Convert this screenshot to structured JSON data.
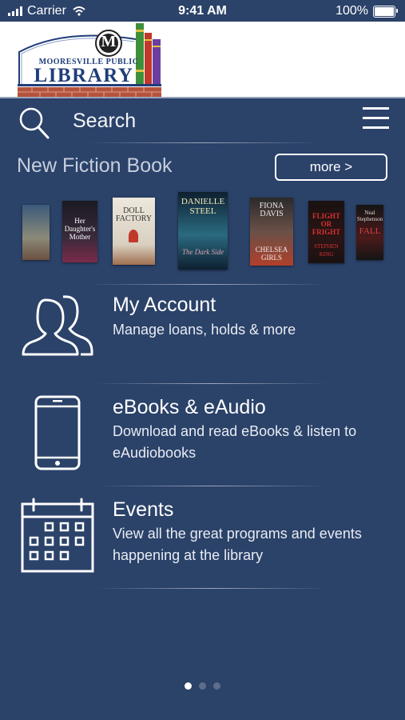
{
  "status_bar": {
    "carrier": "Carrier",
    "time": "9:41 AM",
    "battery": "100%"
  },
  "header": {
    "logo_line1": "MOORESVILLE PUBLIC",
    "logo_line2": "LIBRARY",
    "logo_monogram": "M"
  },
  "search": {
    "label": "Search"
  },
  "new_fiction": {
    "title": "New Fiction Book",
    "more_label": "more >",
    "books": [
      {
        "title": "",
        "author": ""
      },
      {
        "title": "Her Daughter's Mother",
        "author": ""
      },
      {
        "title": "DOLL FACTORY",
        "author": ""
      },
      {
        "title": "The Dark Side",
        "author": "DANIELLE STEEL"
      },
      {
        "title": "CHELSEA GIRLS",
        "author": "FIONA DAVIS"
      },
      {
        "title": "FLIGHT OR FRIGHT",
        "author": "STEPHEN KING"
      },
      {
        "title": "FALL",
        "author": "Neal Stephenson"
      }
    ]
  },
  "menu": [
    {
      "title": "My Account",
      "desc": "Manage loans, holds & more",
      "icon": "users-icon"
    },
    {
      "title": "eBooks & eAudio",
      "desc": "Download and read eBooks & listen to eAudiobooks",
      "icon": "phone-icon"
    },
    {
      "title": "Events",
      "desc": "View all the great programs and events happening at the library",
      "icon": "calendar-icon"
    }
  ],
  "pagination": {
    "pages": 3,
    "current": 1
  },
  "colors": {
    "background": "#2b4269",
    "logo_blue": "#1f3d7a"
  }
}
